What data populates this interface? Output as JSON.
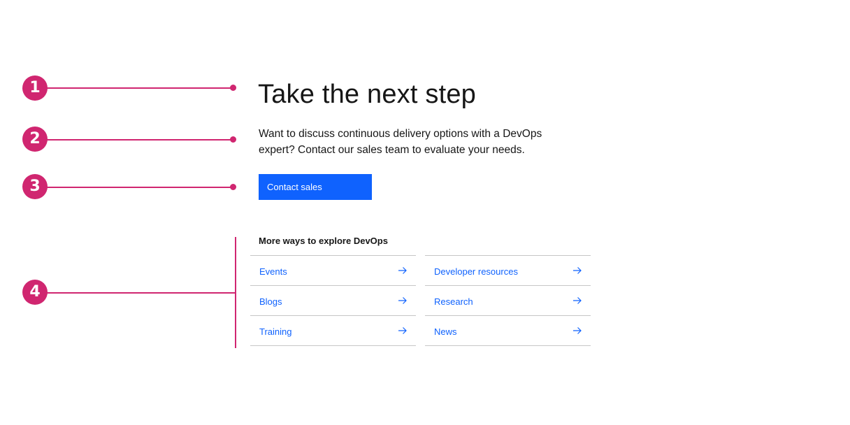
{
  "markers": [
    "1",
    "2",
    "3",
    "4"
  ],
  "title": "Take the next step",
  "body": "Want to discuss continuous delivery options with a DevOps expert? Contact our sales team to evaluate your needs.",
  "cta": {
    "label": "Contact sales"
  },
  "links": {
    "heading": "More ways to explore DevOps",
    "left": [
      {
        "label": "Events",
        "icon": "arrow-right-icon"
      },
      {
        "label": "Blogs",
        "icon": "arrow-right-icon"
      },
      {
        "label": "Training",
        "icon": "arrow-right-icon"
      }
    ],
    "right": [
      {
        "label": "Developer resources",
        "icon": "arrow-right-icon"
      },
      {
        "label": "Research",
        "icon": "arrow-right-icon"
      },
      {
        "label": "News",
        "icon": "arrow-right-icon"
      }
    ]
  },
  "colors": {
    "annotation": "#d02670",
    "primary_button": "#0f62fe",
    "link": "#0f62fe",
    "text": "#161616",
    "divider": "#c6c6c6"
  }
}
